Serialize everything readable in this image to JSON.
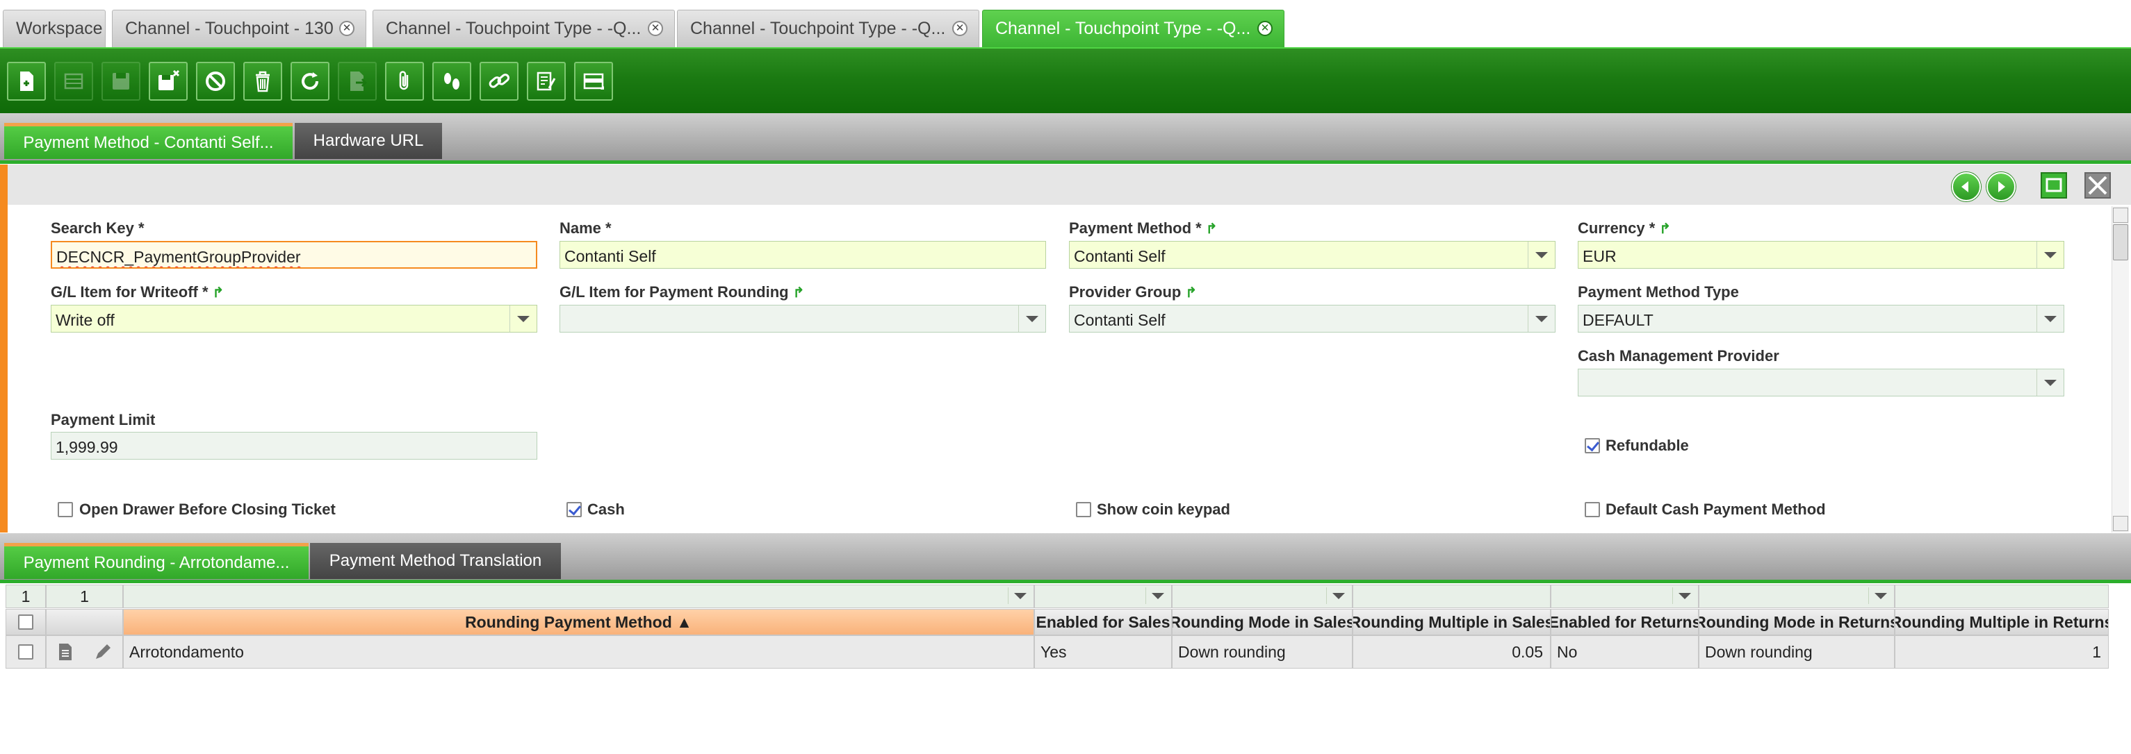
{
  "window_tabs": [
    {
      "label": "Workspace",
      "closable": false,
      "active": false
    },
    {
      "label": "Channel - Touchpoint - 130",
      "closable": true,
      "active": false
    },
    {
      "label": "Channel - Touchpoint Type - -Q...",
      "closable": true,
      "active": false
    },
    {
      "label": "Channel - Touchpoint Type - -Q...",
      "closable": true,
      "active": false
    },
    {
      "label": "Channel - Touchpoint Type - -Q...",
      "closable": true,
      "active": true
    }
  ],
  "toolbar": {
    "buttons": [
      {
        "icon": "new-document-icon",
        "enabled": true
      },
      {
        "icon": "grid-view-icon",
        "enabled": false
      },
      {
        "icon": "save-icon",
        "enabled": false
      },
      {
        "icon": "save-close-icon",
        "enabled": true
      },
      {
        "icon": "undo-icon",
        "enabled": true
      },
      {
        "icon": "delete-icon",
        "enabled": true
      },
      {
        "icon": "refresh-icon",
        "enabled": true
      },
      {
        "icon": "export-icon",
        "enabled": false
      },
      {
        "icon": "attachment-icon",
        "enabled": true
      },
      {
        "icon": "audit-trail-icon",
        "enabled": true
      },
      {
        "icon": "link-icon",
        "enabled": true
      },
      {
        "icon": "process-icon",
        "enabled": true
      },
      {
        "icon": "tab-config-icon",
        "enabled": true
      }
    ]
  },
  "section1_tabs": [
    {
      "label": "Payment Method - Contanti Self...",
      "active": true
    },
    {
      "label": "Hardware URL",
      "active": false
    }
  ],
  "form": {
    "search_key": {
      "label": "Search Key *",
      "value": "DECNCR_PaymentGroupProvider"
    },
    "name": {
      "label": "Name *",
      "value": "Contanti Self"
    },
    "payment_method": {
      "label": "Payment Method *",
      "value": "Contanti Self"
    },
    "currency": {
      "label": "Currency *",
      "value": "EUR"
    },
    "gl_writeoff": {
      "label": "G/L Item for Writeoff *",
      "value": "Write off"
    },
    "gl_rounding": {
      "label": "G/L Item for Payment Rounding",
      "value": ""
    },
    "provider_group": {
      "label": "Provider Group",
      "value": "Contanti Self"
    },
    "payment_method_type": {
      "label": "Payment Method Type",
      "value": "DEFAULT"
    },
    "cash_mgmt_provider": {
      "label": "Cash Management Provider",
      "value": ""
    },
    "payment_limit": {
      "label": "Payment Limit",
      "value": "1,999.99"
    },
    "refundable": {
      "label": "Refundable",
      "checked": true
    },
    "open_drawer": {
      "label": "Open Drawer Before Closing Ticket",
      "checked": false
    },
    "cash": {
      "label": "Cash",
      "checked": true
    },
    "show_coin_keypad": {
      "label": "Show coin keypad",
      "checked": false
    },
    "default_cash": {
      "label": "Default Cash Payment Method",
      "checked": false
    }
  },
  "section2_tabs": [
    {
      "label": "Payment Rounding - Arrotondame...",
      "active": true
    },
    {
      "label": "Payment Method Translation",
      "active": false
    }
  ],
  "grid": {
    "count_left": "1",
    "count_right": "1",
    "columns": [
      "Rounding Payment Method",
      "Enabled for Sales",
      "Rounding Mode in Sales",
      "Rounding Multiple in Sales",
      "Enabled for Returns",
      "Rounding Mode in Returns",
      "Rounding Multiple in Returns"
    ],
    "sort_indicator": "▲",
    "rows": [
      {
        "cells": [
          "Arrotondamento",
          "Yes",
          "Down rounding",
          "0.05",
          "No",
          "Down rounding",
          "1"
        ]
      }
    ]
  },
  "colors": {
    "brand_green": "#2cae2c",
    "active_tab": "#3cb534",
    "toolbar_green": "#1b7a12",
    "accent_orange": "#f58a1f",
    "required_field_bg": "#f6ffd6"
  }
}
